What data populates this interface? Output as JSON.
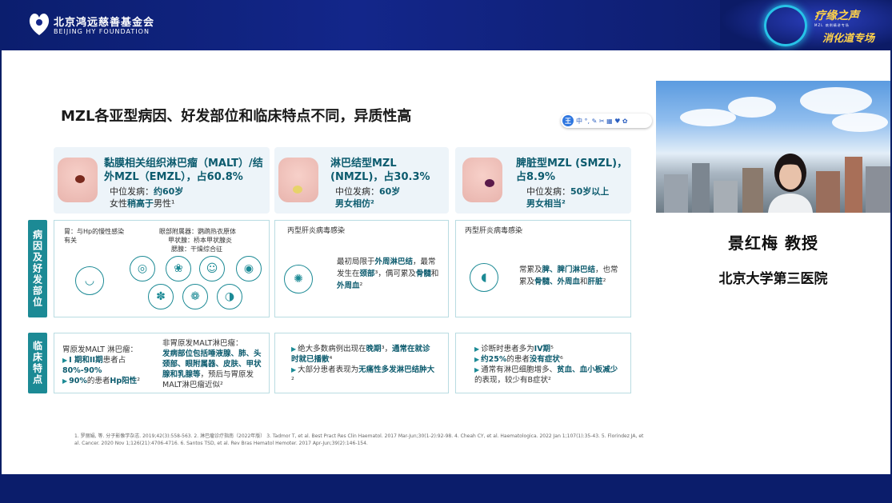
{
  "header": {
    "org_cn": "北京鸿远慈善基金会",
    "org_en": "BEIJING HY FOUNDATION",
    "brand_line1": "疗缘之声",
    "brand_line2": "MZL 病例精讲专场",
    "brand_line3": "消化道专场"
  },
  "slide": {
    "title": "MZL各亚型病因、好发部位和临床特点不同，异质性高",
    "toolbar": {
      "circle": "王",
      "items": "中 °, ✎ ✂ ▦ ♥ ✿"
    },
    "types": [
      {
        "name": "黏膜相关组织淋巴瘤（MALT）/结外MZL（EMZL），占60.8%",
        "age_label": "中位发病：",
        "age": "约60岁",
        "sex_label": "女性",
        "sex": "稍高于",
        "sex_tail": "男性¹"
      },
      {
        "name": "淋巴结型MZL (NMZL)，占30.3%",
        "age_label": "中位发病：",
        "age": "60岁",
        "sex": "男女相仿²"
      },
      {
        "name": "脾脏型MZL (SMZL)，占8.9%",
        "age_label": "中位发病：",
        "age": "50岁以上",
        "sex": "男女相当²"
      }
    ],
    "side_labels": {
      "etiology": "病因及好发部位",
      "clinical": "临床特点"
    },
    "etiology": {
      "malt_left": "胃：与Hp的慢性感染有关",
      "malt_right_1": "眼部附属器：鹦鹉热衣原体",
      "malt_right_2": "甲状腺：桥本甲状腺炎",
      "malt_right_3": "腮腺：干燥综合征",
      "nmzl_head": "丙型肝炎病毒感染",
      "nmzl_text_a": "最初局限于",
      "nmzl_text_b": "外周淋巴结",
      "nmzl_text_c": "，最常发生在",
      "nmzl_text_d": "颈部",
      "nmzl_text_e": "³，偶可累及",
      "nmzl_text_f": "骨髓",
      "nmzl_text_g": "和",
      "nmzl_text_h": "外周血",
      "nmzl_text_i": "²",
      "smzl_head": "丙型肝炎病毒感染",
      "smzl_text_a": "常累及",
      "smzl_text_b": "脾、脾门淋巴结",
      "smzl_text_c": "，也常累及",
      "smzl_text_d": "骨髓、外周血",
      "smzl_text_e": "和",
      "smzl_text_f": "肝脏",
      "smzl_text_g": "²"
    },
    "clinical": {
      "malt_l1": "胃原发MALT 淋巴瘤：",
      "malt_l2": "I 期和II期",
      "malt_l3": "患者占",
      "malt_l4": "80%-90%",
      "malt_l5": "90%",
      "malt_l6": "的患者",
      "malt_l7": "Hp阳性",
      "malt_l8": "²",
      "malt_r1": "非胃原发MALT淋巴瘤：",
      "malt_r2": "发病部位包括唾液腺、肺、头颈部、眼附属器、皮肤、甲状腺和乳腺等",
      "malt_r3": "，预后与胃原发MALT淋巴瘤近似²",
      "nmzl_1a": "绝大多数病例出现在",
      "nmzl_1b": "晚期",
      "nmzl_1c": "³，",
      "nmzl_1d": "通常在就诊时就已播散",
      "nmzl_1e": "⁴",
      "nmzl_2a": "大部分患者表现为",
      "nmzl_2b": "无痛性多发淋巴结肿大",
      "nmzl_2c": "²",
      "smzl_1a": "诊断时患者多为",
      "smzl_1b": "IV期",
      "smzl_1c": "⁵",
      "smzl_2a": "约25%",
      "smzl_2b": "的患者",
      "smzl_2c": "没有症状",
      "smzl_2d": "⁶",
      "smzl_3a": "通常有淋巴细胞增多、",
      "smzl_3b": "贫血、血小板减少",
      "smzl_3c": "的表现，较少有B症状²"
    },
    "refs": "1. 罗丽娟, 等. 分子影像学杂志. 2019;42(3):558-563.   2. 淋巴瘤诊疗指南（2022年版）  3. Tadmor T, et al. Best Pract Res Clin Haematol. 2017 Mar-Jun;30(1-2):92-98. 4. Cheah CY, et al. Haematologica. 2022 Jan 1;107(1):35-43. 5. Florindez JA, et al. Cancer. 2020 Nov 1;126(21):4706-4716.   6. Santos TSD, et al. Rev Bras Hematol Hemoter. 2017 Apr-Jun;39(2):146-154."
  },
  "speaker": {
    "name": "景红梅 教授",
    "hospital": "北京大学第三医院"
  },
  "colors": {
    "navy": "#0b1d6b",
    "teal": "#1c8a95",
    "accent_text": "#0c5b6e"
  }
}
